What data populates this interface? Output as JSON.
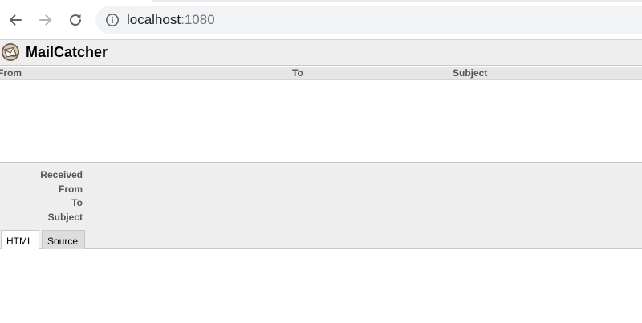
{
  "browser": {
    "url_host": "localhost",
    "url_port": ":1080",
    "icons": {
      "back": "arrow-left-icon",
      "forward": "arrow-right-icon",
      "reload": "reload-icon",
      "site_info": "info-icon"
    }
  },
  "app": {
    "title": "MailCatcher",
    "logo": "mailcatcher-logo-icon"
  },
  "message_list": {
    "columns": [
      "From",
      "To",
      "Subject"
    ],
    "rows": []
  },
  "message_detail": {
    "labels": {
      "received": "Received",
      "from": "From",
      "to": "To",
      "subject": "Subject"
    },
    "tabs": [
      "HTML",
      "Source"
    ],
    "active_tab": "HTML"
  },
  "colors": {
    "header_bg": "#eeeeee",
    "column_header_bg": "#e6e6e6",
    "label_text": "#555555",
    "inactive_tab_bg": "#dddddd"
  }
}
